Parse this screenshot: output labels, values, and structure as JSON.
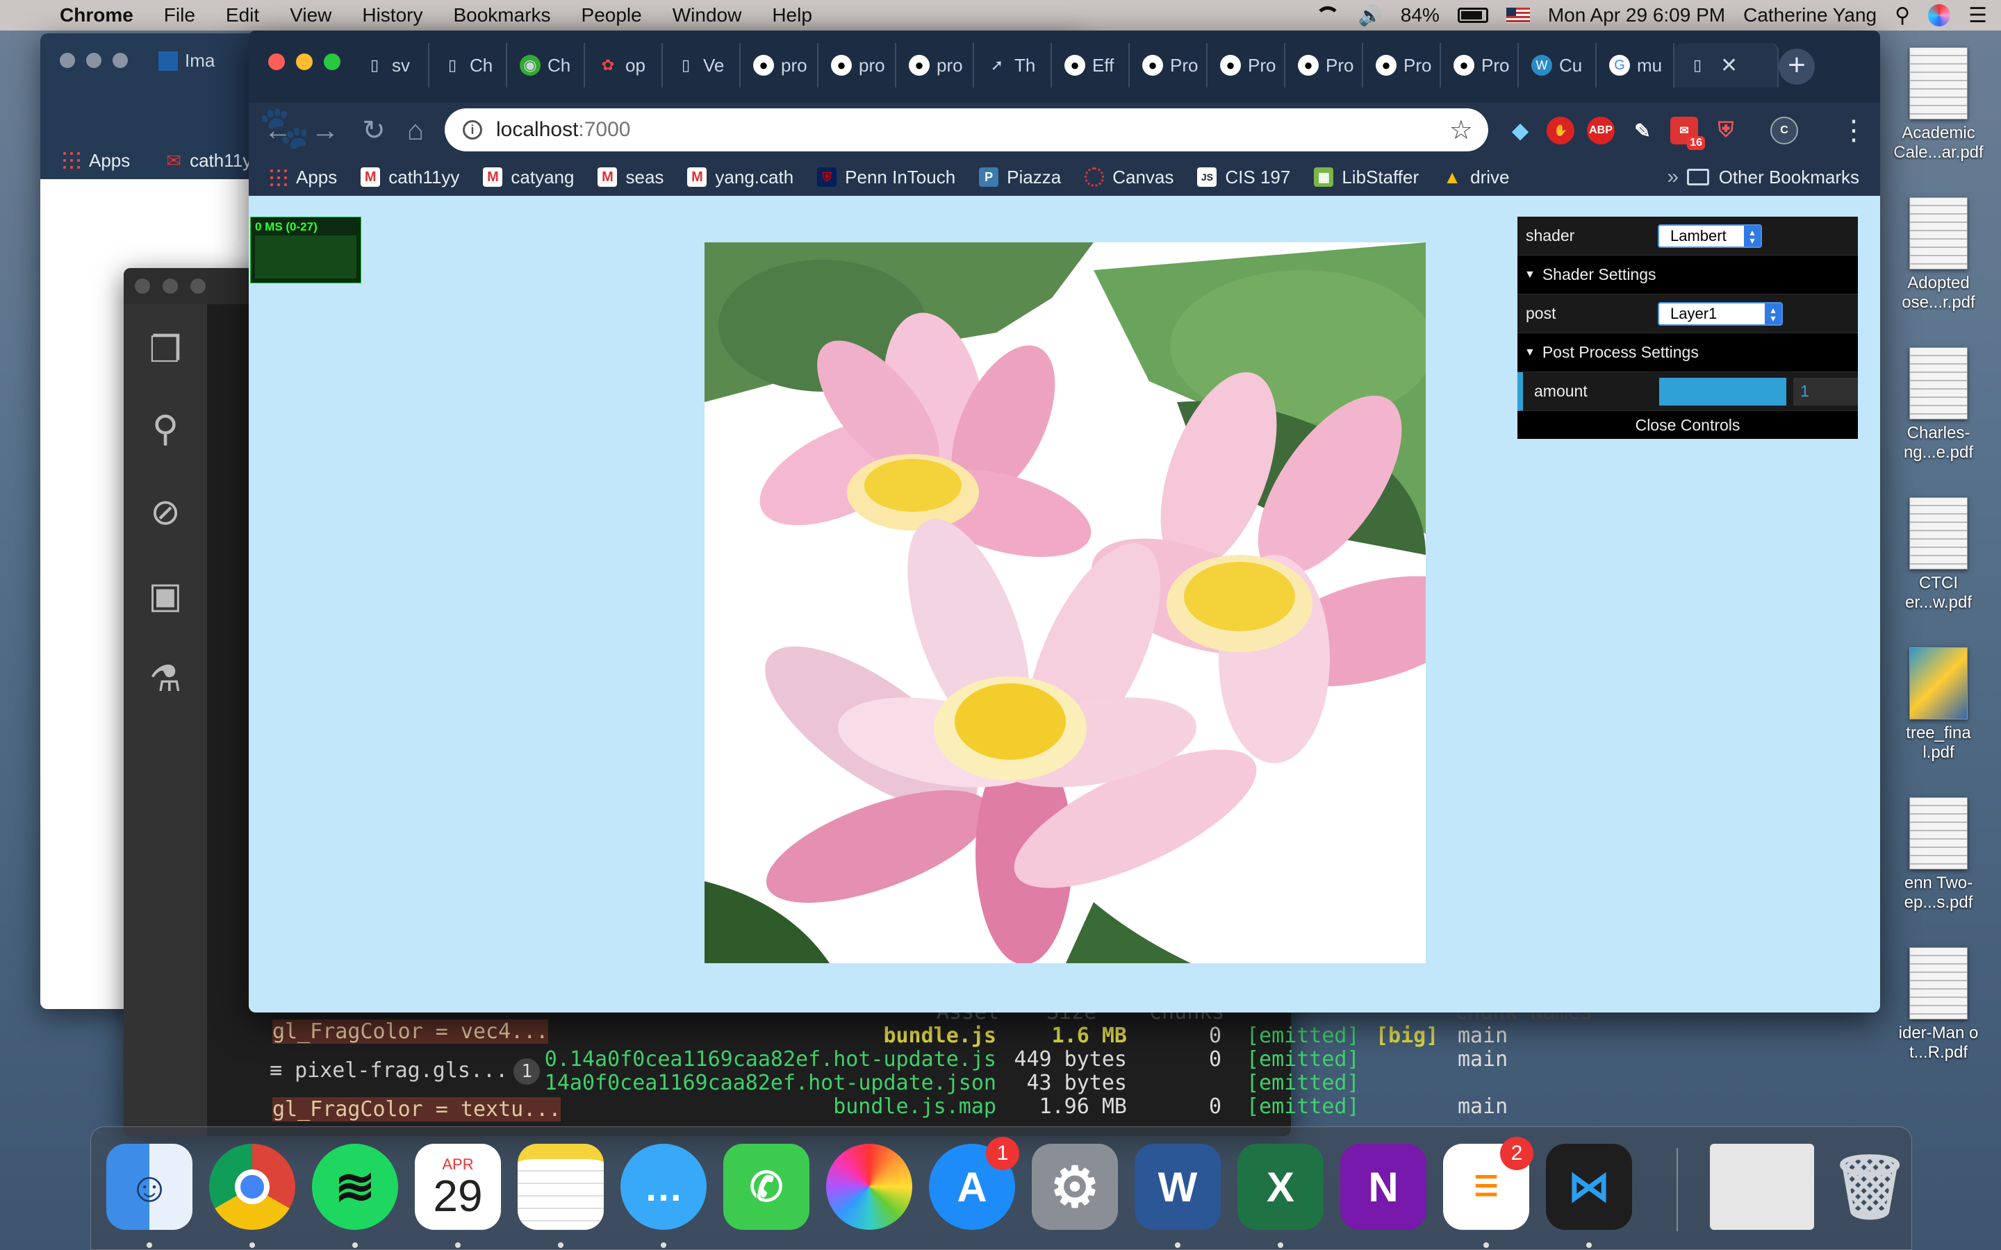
{
  "menubar": {
    "app": "Chrome",
    "items": [
      "File",
      "Edit",
      "View",
      "History",
      "Bookmarks",
      "People",
      "Window",
      "Help"
    ],
    "battery": "84%",
    "datetime": "Mon Apr 29  6:09 PM",
    "user": "Catherine Yang"
  },
  "back_window": {
    "tab_label": "Ima",
    "bookmark": "cath11y",
    "apps_label": "Apps"
  },
  "chrome": {
    "tabs": [
      "sv",
      "Ch",
      "Ch",
      "op",
      "Ve",
      "pro",
      "pro",
      "pro",
      "Th",
      "Eff",
      "Pro",
      "Pro",
      "Pro",
      "Pro",
      "Pro",
      "Cu",
      "mu"
    ],
    "url_host": "localhost",
    "url_port": ":7000",
    "bookmarks": [
      "Apps",
      "cath11yy",
      "catyang",
      "seas",
      "yang.cath",
      "Penn InTouch",
      "Piazza",
      "Canvas",
      "CIS 197",
      "LibStaffer",
      "drive"
    ],
    "bookmarks_chevron": "»",
    "other_bookmarks": "Other Bookmarks",
    "ext_abp": "ABP",
    "ext_mail_count": "16",
    "profile_initial": "C"
  },
  "stats": {
    "label": "0 MS (0-27)"
  },
  "gui": {
    "shader_label": "shader",
    "shader_value": "Lambert",
    "shader_folder": "Shader Settings",
    "post_label": "post",
    "post_value": "Layer1",
    "post_folder": "Post Process Settings",
    "amount_label": "amount",
    "amount_value": "1",
    "amount_fraction": 1.0,
    "close_label": "Close Controls"
  },
  "vscode": {
    "editor_snippets": [
      "gl_FragColor = vec4...",
      "pixel-frag.gls...",
      "gl_FragColor = textu..."
    ],
    "badge": "1"
  },
  "terminal": {
    "header": [
      "Asset",
      "Size",
      "Chunks",
      "Chunk Names"
    ],
    "rows": [
      {
        "asset": "bundle.js",
        "size": "1.6 MB",
        "chunks": "0",
        "status": "[emitted]",
        "flag": "[big]",
        "name": "main"
      },
      {
        "asset": "0.14a0f0cea1169caa82ef.hot-update.js",
        "size": "449 bytes",
        "chunks": "0",
        "status": "[emitted]",
        "flag": "",
        "name": "main"
      },
      {
        "asset": "14a0f0cea1169caa82ef.hot-update.json",
        "size": "43 bytes",
        "chunks": "",
        "status": "[emitted]",
        "flag": "",
        "name": ""
      },
      {
        "asset": "bundle.js.map",
        "size": "1.96 MB",
        "chunks": "0",
        "status": "[emitted]",
        "flag": "",
        "name": "main"
      }
    ]
  },
  "desktop_files": [
    "Academic Cale...ar.pdf",
    "Adopted ose...r.pdf",
    "Charles- ng...e.pdf",
    "CTCI er...w.pdf",
    "tree_fina l.pdf",
    "enn Two- ep...s.pdf",
    "ider-Man o t...R.pdf"
  ],
  "dock": {
    "calendar_month": "APR",
    "calendar_day": "29",
    "appstore_badge": "1",
    "reminders_badge": "2"
  },
  "colors": {
    "viewport_bg": "#c2e6fa",
    "gui_accent": "#2fa1d6",
    "chrome_frame": "#23344c"
  }
}
